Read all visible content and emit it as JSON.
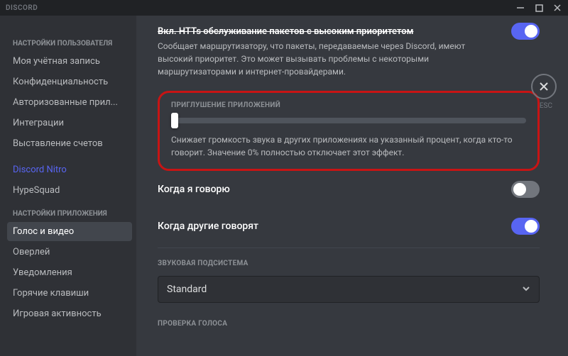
{
  "app": {
    "name": "DISCORD"
  },
  "closeLabel": "ESC",
  "sidebar": {
    "header1": "НАСТРОЙКИ ПОЛЬЗОВАТЕЛЯ",
    "items1": [
      "Моя учётная запись",
      "Конфиденциальность",
      "Авторизованные прил...",
      "Интеграции",
      "Выставление счетов"
    ],
    "nitro": "Discord Nitro",
    "hype": "HypeSquad",
    "header2": "НАСТРОЙКИ ПРИЛОЖЕНИЯ",
    "items2": [
      "Голос и видео",
      "Оверлей",
      "Уведомления",
      "Горячие клавиши",
      "Игровая активность"
    ]
  },
  "top": {
    "title": "Вкл. HTTs обслуживание пакетов с высоким приоритетом",
    "desc": "Сообщает маршрутизатору, что пакеты, передаваемые через Discord, имеют высокий приоритет. Это может вызывать проблемы с некоторыми маршрутизаторами и интернет-провайдерами."
  },
  "attenuation": {
    "label": "ПРИГЛУШЕНИЕ ПРИЛОЖЕНИЙ",
    "desc": "Снижает громкость звука в других приложениях на указанный процент, когда кто-то говорит. Значение 0% полностью отключает этот эффект.",
    "value": 0
  },
  "rows": {
    "when_i_speak": "Когда я говорю",
    "when_others_speak": "Когда другие говорят"
  },
  "audio": {
    "label": "ЗВУКОВАЯ ПОДСИСТЕМА",
    "value": "Standard"
  },
  "voice_check": {
    "label": "ПРОВЕРКА ГОЛОСА"
  }
}
